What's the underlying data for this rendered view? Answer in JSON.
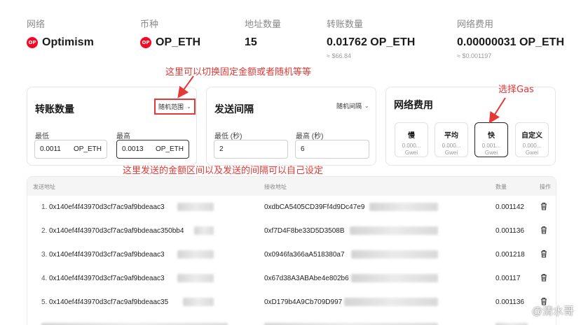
{
  "summary": {
    "network": {
      "label": "网络",
      "value": "Optimism"
    },
    "currency": {
      "label": "币种",
      "value": "OP_ETH"
    },
    "address_count": {
      "label": "地址数量",
      "value": "15"
    },
    "transfer_amount": {
      "label": "转账数量",
      "value": "0.01762 OP_ETH",
      "sub": "≈ $66.84"
    },
    "network_fee": {
      "label": "网络费用",
      "value": "0.00000031 OP_ETH",
      "sub": "≈ $0.001197"
    },
    "logo_text": "OP"
  },
  "amount_card": {
    "title": "转账数量",
    "mode": "随机范围",
    "min_label": "最低",
    "max_label": "最高",
    "min_value": "0.0011",
    "max_value": "0.0013",
    "unit": "OP_ETH"
  },
  "interval_card": {
    "title": "发送间隔",
    "mode": "随机间隔",
    "min_label": "最低 (秒)",
    "max_label": "最高 (秒)",
    "min_value": "2",
    "max_value": "6"
  },
  "gas_card": {
    "title": "网络费用",
    "options": [
      {
        "name": "慢",
        "value": "0.000...",
        "unit": "Gwei"
      },
      {
        "name": "平均",
        "value": "0.000...",
        "unit": "Gwei"
      },
      {
        "name": "快",
        "value": "0.001...",
        "unit": "Gwei"
      },
      {
        "name": "自定义",
        "value": "0.000...",
        "unit": "Gwei"
      }
    ],
    "selected": "快"
  },
  "annotations": {
    "top": "这里可以切换固定金额或者随机等等",
    "gas": "选择Gas",
    "bottom": "这里发送的金额区间以及发送的间隔可以自己设定"
  },
  "table": {
    "headers": {
      "from": "发送地址",
      "to": "接收地址",
      "amount": "数量",
      "action": "操作"
    },
    "rows": [
      {
        "idx": "1.",
        "from": "0x140ef4f43970d3cf7ac9af9bdeaac3",
        "to": "0xdbCA5405CD39Ff4d9Dc47e9",
        "amount": "0.001142"
      },
      {
        "idx": "2.",
        "from": "0x140ef4f43970d3cf7ac9af9bdeaac350bb4",
        "to": "0xf7D4F8be33D5D3508B",
        "amount": "0.001136"
      },
      {
        "idx": "3.",
        "from": "0x140ef4f43970d3cf7ac9af9bdeaac3",
        "to": "0x0946fa366aA518380a7",
        "amount": "0.001218"
      },
      {
        "idx": "4.",
        "from": "0x140ef4f43970d3cf7ac9af9bdeaac3",
        "to": "0x67d38A3ABAbe4e802b6",
        "amount": "0.00117"
      },
      {
        "idx": "5.",
        "from": "0x140ef4f43970d3cf7ac9af9bdeaac35",
        "to": "0xD179b4A9Cb709D997",
        "amount": "0.001136"
      }
    ]
  },
  "watermark": "@清水哥"
}
